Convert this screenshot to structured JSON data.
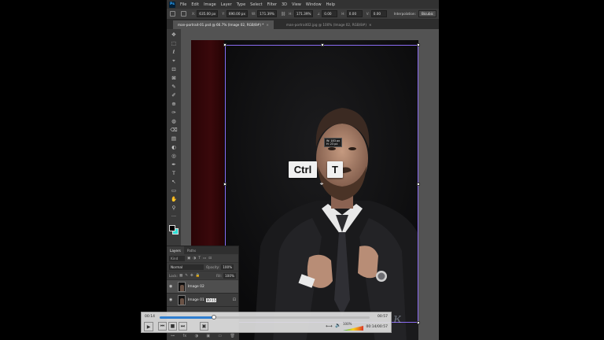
{
  "app": {
    "logo": "Ps"
  },
  "menu": [
    "File",
    "Edit",
    "Image",
    "Layer",
    "Type",
    "Select",
    "Filter",
    "3D",
    "View",
    "Window",
    "Help"
  ],
  "options": {
    "x_label": "X:",
    "x_value": "635.00 px",
    "y_label": "Y:",
    "y_value": "690.00 px",
    "w_label": "W:",
    "w_value": "171.39%",
    "h_label": "H:",
    "h_value": "171.39%",
    "angle_label": "∠",
    "angle_value": "0.00",
    "hskew_label": "H:",
    "hskew_value": "0.00",
    "vskew_label": "V:",
    "vskew_value": "0.00",
    "interpolation_label": "Interpolation:",
    "interpolation_value": "Bicubic"
  },
  "tabs": [
    {
      "label": "man-portrait-01.psd @ 66.7% (Image 02, RGB/8#) *",
      "close": "×"
    },
    {
      "label": "man-portrait02.jpg @ 100% (Image 02, RGB/8#)",
      "close": "×"
    }
  ],
  "tools": [
    "✥",
    "⬚",
    "ℓ",
    "⌖",
    "⊡",
    "⊠",
    "✎",
    "✐",
    "⊕",
    "✑",
    "◍",
    "⌫",
    "▤",
    "◐",
    "◎",
    "✒",
    "T",
    "↖",
    "▭",
    "✋",
    "⚲",
    "···"
  ],
  "colors": {
    "foreground": "#000000",
    "background": "#2fe0d6",
    "transform_box": "#8a6bf2"
  },
  "transform": {
    "readout_w": "W: 183 px",
    "readout_h": "H: 23 px",
    "center": "⌖"
  },
  "keys": {
    "ctrl": "Ctrl",
    "t": "T"
  },
  "layers_panel": {
    "tabs": [
      "Layers",
      "Paths"
    ],
    "filter_label": "Kind",
    "blend_mode": "Normal",
    "opacity_label": "Opacity:",
    "opacity_value": "100%",
    "lock_label": "Lock:",
    "fill_label": "Fill:",
    "fill_value": "100%",
    "layers": [
      {
        "name": "Image 02",
        "chip": ""
      },
      {
        "name": "Image 01",
        "chip": "00:15"
      }
    ],
    "footer_icons": [
      "⊶",
      "fx",
      "◑",
      "▣",
      "▭",
      "🗑"
    ]
  },
  "player": {
    "time_current": "00:14",
    "time_total": "00:57",
    "progress": 0.26,
    "volume_label": "100%",
    "time_readout": "00:14/00:57",
    "buttons": [
      "▶",
      "⏮",
      "■",
      "⏭",
      "▣"
    ]
  },
  "watermark": "ĸ"
}
